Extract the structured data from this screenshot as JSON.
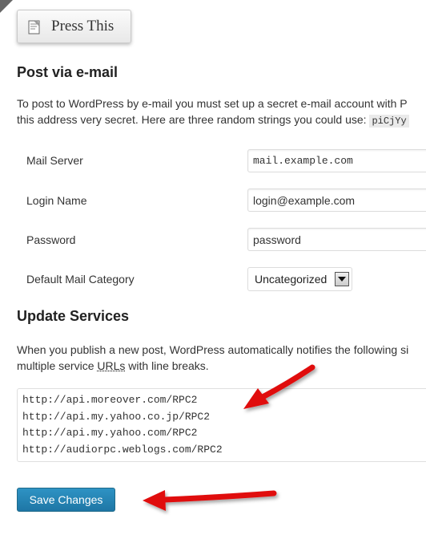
{
  "press_this": {
    "label": "Press This"
  },
  "post_via_email": {
    "heading": "Post via e-mail",
    "description_line1": "To post to WordPress by e-mail you must set up a secret e-mail account with P",
    "description_line2": "this address very secret. Here are three random strings you could use:",
    "random_string": "piCjYy",
    "fields": {
      "mail_server": {
        "label": "Mail Server",
        "value": "mail.example.com"
      },
      "login_name": {
        "label": "Login Name",
        "value": "login@example.com"
      },
      "password": {
        "label": "Password",
        "value": "password"
      },
      "default_category": {
        "label": "Default Mail Category",
        "value": "Uncategorized"
      }
    }
  },
  "update_services": {
    "heading": "Update Services",
    "description_line1": "When you publish a new post, WordPress automatically notifies the following si",
    "description_line2_a": "multiple service ",
    "description_line2_abbr": "URLs",
    "description_line2_b": " with line breaks.",
    "services": [
      "http://api.moreover.com/RPC2",
      "http://api.my.yahoo.co.jp/RPC2",
      "http://api.my.yahoo.com/RPC2",
      "http://audiorpc.weblogs.com/RPC2"
    ]
  },
  "save": {
    "label": "Save Changes"
  },
  "colors": {
    "arrow": "#e01010",
    "button_primary": "#2e93c4"
  },
  "icons": {
    "press_this": "document-icon",
    "select": "chevron-down-icon",
    "annotation": "red-arrow-icon"
  }
}
